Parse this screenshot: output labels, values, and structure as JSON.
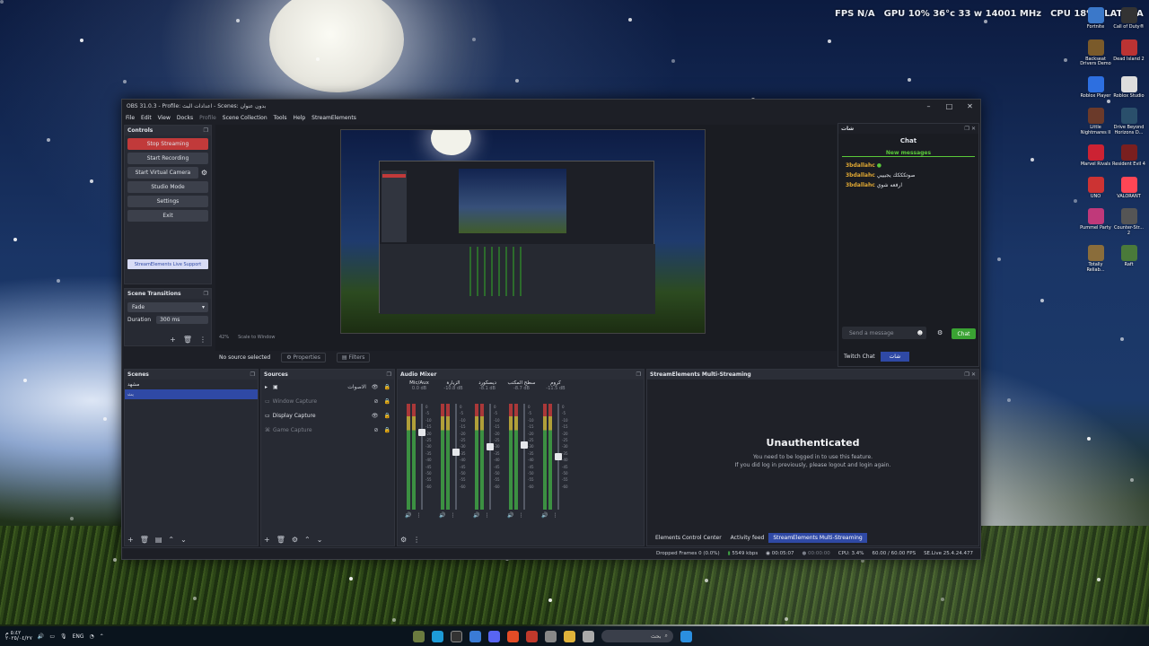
{
  "overlay": {
    "fps_label": "FPS",
    "fps_value": "N/A",
    "gpu_label": "GPU",
    "gpu_value": "10%  36°c  33 w  14001 MHz",
    "cpu_label": "CPU",
    "cpu_value": "18%",
    "lat_label": "LAT",
    "lat_value": "N/A"
  },
  "desktop_icons": [
    "Fortnite",
    "Call of Duty®",
    "Backseat Drivers Demo",
    "Dead Island 2",
    "Roblox Player",
    "Roblox Studio",
    "Little Nightmares II",
    "Drive Beyond Horizons D...",
    "Marvel Rivals",
    "Resident Evil 4",
    "UNO",
    "VALORANT",
    "Pummel Party",
    "Counter-Str... 2",
    "Totally Reliab...",
    "Raft"
  ],
  "window": {
    "title": "OBS 31.0.3 - Profile: اعدادات البث - Scenes: بدون عنوان"
  },
  "menu": [
    "File",
    "Edit",
    "View",
    "Docks",
    "Profile",
    "Scene Collection",
    "Tools",
    "Help",
    "StreamElements"
  ],
  "controls": {
    "title": "Controls",
    "stop_streaming": "Stop Streaming",
    "start_recording": "Start Recording",
    "start_virtual_camera": "Start Virtual Camera",
    "studio_mode": "Studio Mode",
    "settings": "Settings",
    "exit": "Exit",
    "live_support": "StreamElements Live Support"
  },
  "transitions": {
    "title": "Scene Transitions",
    "type": "Fade",
    "duration_label": "Duration",
    "duration_value": "300 ms"
  },
  "preview": {
    "zoom": "42%",
    "scale_label": "Scale to Window"
  },
  "context_bar": {
    "no_source": "No source selected",
    "properties": "Properties",
    "filters": "Filters"
  },
  "scenes": {
    "title": "Scenes",
    "items": [
      "مشهد",
      "بث"
    ]
  },
  "sources": {
    "title": "Sources",
    "items": [
      "الاصوات",
      "Window Capture",
      "Display Capture",
      "Game Capture"
    ]
  },
  "mixer": {
    "title": "Audio Mixer",
    "channels": [
      {
        "name": "Mic/Aux",
        "db": "0.0 dB",
        "level": 0.75
      },
      {
        "name": "الزيارة",
        "db": "-10.8 dB",
        "level": 0.55
      },
      {
        "name": "ديسكورد",
        "db": "-8.1 dB",
        "level": 0.6
      },
      {
        "name": "سطح المكتب",
        "db": "-8.7 dB",
        "level": 0.62
      },
      {
        "name": "كروم",
        "db": "-11.5 dB",
        "level": 0.5
      }
    ],
    "scale": [
      "0",
      "-5",
      "-10",
      "-15",
      "-20",
      "-25",
      "-30",
      "-35",
      "-40",
      "-45",
      "-50",
      "-55",
      "-60"
    ]
  },
  "multistream": {
    "title": "StreamElements Multi-Streaming",
    "heading": "Unauthenticated",
    "line1": "You need to be logged in to use this feature.",
    "line2": "If you did log in previously, please logout and login again.",
    "tabs": [
      "Elements Control Center",
      "Activity feed",
      "StreamElements Multi-Streaming"
    ]
  },
  "chat": {
    "dock_title": "شات",
    "title": "Chat",
    "new_messages": "New messages",
    "messages": [
      {
        "user": "3bdallahc",
        "text": ""
      },
      {
        "user": "3bdallahc",
        "text": "صوتكككك يجيييي"
      },
      {
        "user": "3bdallahc",
        "text": "ارفعه شوي"
      }
    ],
    "placeholder": "Send a message",
    "send": "Chat",
    "tab_twitch": "Twitch Chat",
    "tab_other": "شات"
  },
  "status": {
    "dropped": "Dropped Frames 0 (0.0%)",
    "kbps": "5549 kbps",
    "stream_time": "00:05:07",
    "rec_time": "00:00:00",
    "cpu": "CPU: 3.4%",
    "fps": "60.00 / 60.00 FPS",
    "version": "SE.Live 25.4.24.477"
  },
  "taskbar": {
    "lang": "ENG",
    "time": "٥:٤٢ م",
    "date": "٢٠٢٥/٠٤/٢٧",
    "search_placeholder": "بحث"
  },
  "colors": {
    "accent": "#2f49a5",
    "stop": "#c13a3a",
    "chat_send": "#3aa333",
    "new_messages": "#5ac93a"
  }
}
